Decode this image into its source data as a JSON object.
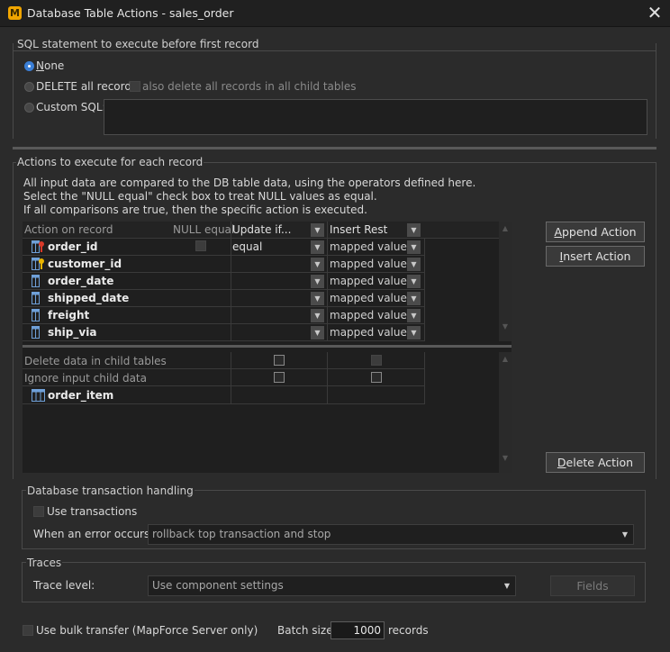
{
  "window": {
    "title": "Database Table Actions - sales_order",
    "app_icon_glyph": "M",
    "close_glyph": "✕"
  },
  "sql_before": {
    "group_label": "SQL statement to execute before first record",
    "opt_none": "None",
    "opt_delete": "DELETE all records",
    "also_delete_label": "also delete all records in all child tables",
    "opt_custom": "Custom SQL:",
    "custom_sql_value": ""
  },
  "actions": {
    "group_label": "Actions to execute for each record",
    "desc1": "All input data are compared to the DB table data, using the operators defined here.",
    "desc2": "Select the \"NULL equal\" check box to treat NULL values as equal.",
    "desc3": "If all comparisons are true, then the specific action is executed.",
    "headers": {
      "action_on_record": "Action on record",
      "null_equal": "NULL equal",
      "update_if": "Update if...",
      "insert_rest": "Insert Rest"
    },
    "rows": [
      {
        "name": "order_id",
        "icon": "primary-key-column-icon",
        "operator": "equal",
        "insert": "mapped value"
      },
      {
        "name": "customer_id",
        "icon": "foreign-key-column-icon",
        "operator": "",
        "insert": "mapped value"
      },
      {
        "name": "order_date",
        "icon": "column-icon",
        "operator": "",
        "insert": "mapped value"
      },
      {
        "name": "shipped_date",
        "icon": "column-icon",
        "operator": "",
        "insert": "mapped value"
      },
      {
        "name": "freight",
        "icon": "column-icon",
        "operator": "",
        "insert": "mapped value"
      },
      {
        "name": "ship_via",
        "icon": "column-icon",
        "operator": "",
        "insert": "mapped value"
      }
    ],
    "delete_child": "Delete data in child tables",
    "ignore_child": "Ignore input child data",
    "child_table": "order_item",
    "append_button": "Append Action",
    "insert_button": "Insert Action",
    "delete_button": "Delete Action"
  },
  "transaction": {
    "group_label": "Database transaction handling",
    "use_transactions": "Use transactions",
    "error_label": "When an error occurs:",
    "error_value": "rollback top transaction and stop"
  },
  "traces": {
    "group_label": "Traces",
    "level_label": "Trace level:",
    "level_value": "Use component settings",
    "fields_button": "Fields"
  },
  "bulk": {
    "label": "Use bulk transfer (MapForce Server only)",
    "batch_label": "Batch size:",
    "batch_value": "1000",
    "records_label": "records"
  },
  "colors": {
    "accent": "#3b7fd6",
    "key_red": "#d83a2a",
    "key_gold": "#e8b400",
    "column_blue": "#6fa0d8"
  }
}
